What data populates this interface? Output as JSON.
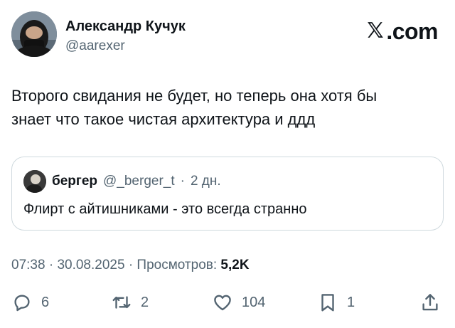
{
  "author": {
    "name": "Александр Кучук",
    "handle": "@aarexer"
  },
  "site": {
    "label": ".com"
  },
  "tweet": {
    "text_line1": "Второго свидания не будет, но теперь она хотя бы",
    "text_line2": "знает что такое чистая архитектура и ддд"
  },
  "quote": {
    "name": "бергер",
    "handle": "@_berger_t",
    "separator": "·",
    "age": "2 дн.",
    "text": "Флирт с айтишниками - это всегда странно"
  },
  "meta": {
    "time": "07:38",
    "dot1": "·",
    "date": "30.08.2025",
    "dot2": "·",
    "views_label": "Просмотров:",
    "views_count": "5,2K"
  },
  "actions": {
    "replies": "6",
    "reposts": "2",
    "likes": "104",
    "bookmarks": "1"
  },
  "icons": [
    "x-logo-icon",
    "reply-icon",
    "repost-icon",
    "like-icon",
    "bookmark-icon",
    "share-icon"
  ],
  "colors": {
    "text": "#0f1419",
    "secondary": "#536471",
    "border": "#cfd9de"
  }
}
